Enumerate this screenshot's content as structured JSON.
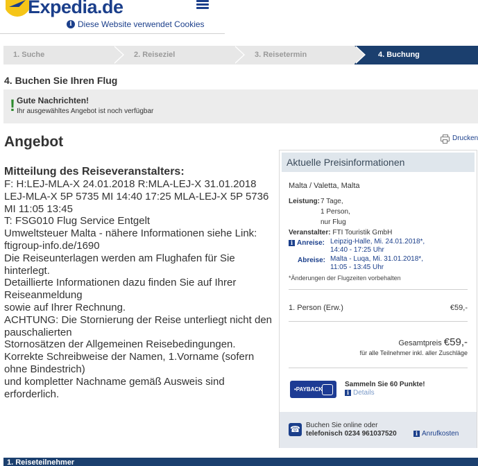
{
  "header": {
    "logo_text": "Expedia.de",
    "cookie_notice": "Diese Website verwendet Cookies",
    "icons": {
      "menu": "hamburger-menu-icon",
      "info": "info-icon"
    }
  },
  "steps": [
    {
      "label": "1. Suche",
      "active": false
    },
    {
      "label": "2. Reiseziel",
      "active": false
    },
    {
      "label": "3. Reisetermin",
      "active": false
    },
    {
      "label": "4. Buchung",
      "active": true
    }
  ],
  "section_title": "4. Buchen Sie Ihren Flug",
  "notice": {
    "mark": "!",
    "title": "Gute Nachrichten!",
    "subtitle": "Ihr ausgewähltes Angebot ist noch verfügbar"
  },
  "offer": {
    "title": "Angebot",
    "print_label": "Drucken",
    "heading": "Mitteilung des Reiseveranstalters:",
    "lines": [
      "F: H:LEJ-MLA-X 24.01.2018 R:MLA-LEJ-X 31.01.2018 LEJ-MLA-X 5P 5735 MI 14:40 17:25 MLA-LEJ-X 5P 5736 MI 11:05 13:45",
      "T: FSG010 Flug Service Entgelt",
      "Umweltsteuer Malta - nähere Informationen siehe Link: ftigroup-info.de/1690",
      "Die Reiseunterlagen werden am Flughafen für Sie hinterlegt.",
      "Detaillierte Informationen dazu finden Sie auf Ihrer Reiseanmeldung",
      "sowie auf Ihrer Rechnung.",
      "ACHTUNG: Die Stornierung der Reise unterliegt nicht den pauschalierten",
      "Stornosätzen der Allgemeinen Reisebedingungen.",
      "Korrekte Schreibweise der Namen, 1.Vorname (sofern ohne Bindestrich)",
      "und kompletter Nachname gemäß Ausweis sind erforderlich."
    ]
  },
  "price_panel": {
    "title": "Aktuelle Preisinformationen",
    "destination": "Malta / Valetta, Malta",
    "leistung_label": "Leistung:",
    "leistung_lines": [
      "7 Tage,",
      "1 Person,",
      "nur Flug"
    ],
    "veranstalter_label": "Veranstalter:",
    "veranstalter": "FTI Touristik GmbH",
    "anreise_label": "Anreise:",
    "anreise_line1": "Leipzig-Halle, Mi. 24.01.2018*,",
    "anreise_line2": "14:40 - 17:25 Uhr",
    "abreise_label": "Abreise:",
    "abreise_line1": "Malta - Luqa, Mi. 31.01.2018*,",
    "abreise_line2": "11:05 - 13:45 Uhr",
    "note": "*Änderungen der Flugzeiten vorbehalten",
    "person_label": "1. Person (Erw.)",
    "person_price": "€59,-",
    "total_label": "Gesamtpreis",
    "total_price": "€59,-",
    "total_sub": "für alle Teilnehmer inkl. aller Zuschläge",
    "payback_logo": "•PAYBACK",
    "payback_title": "Sammeln Sie 60 Punkte!",
    "payback_details": "Details",
    "phone_line1": "Buchen Sie online oder",
    "phone_line2": "telefonisch  0234  961037520",
    "phone_cost": "Anrufkosten"
  },
  "bottom_bar": "1. Reiseteilnehmer"
}
